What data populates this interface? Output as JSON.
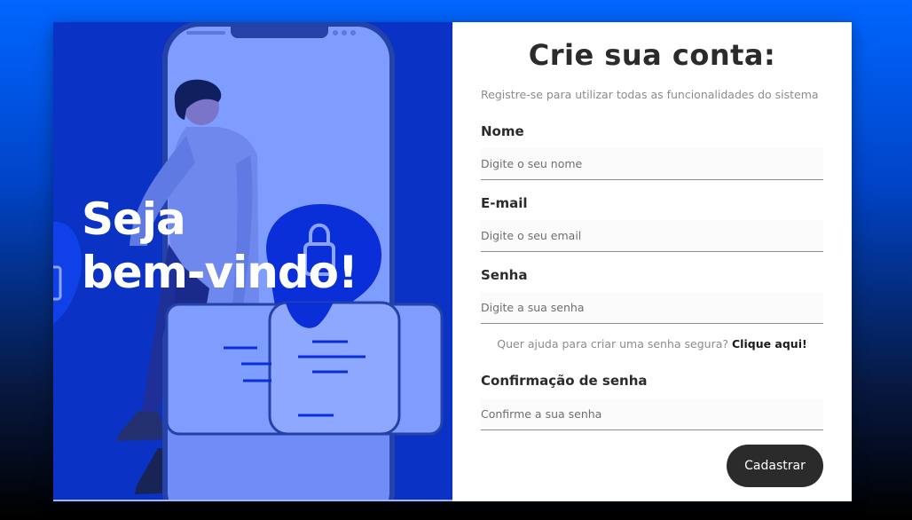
{
  "hero": {
    "line1": "Seja",
    "line2": "bem-vindo!"
  },
  "form": {
    "title": "Crie sua conta:",
    "subtitle": "Registre-se para utilizar todas as funcionalidades do sistema",
    "fields": [
      {
        "label": "Nome",
        "placeholder": "Digite o seu nome",
        "value": ""
      },
      {
        "label": "E-mail",
        "placeholder": "Digite o seu email",
        "value": ""
      },
      {
        "label": "Senha",
        "placeholder": "Digite a sua senha",
        "value": ""
      },
      {
        "label": "Confirmação de senha",
        "placeholder": "Confirme a sua senha",
        "value": ""
      }
    ],
    "help_text": "Quer ajuda para criar uma senha segura?",
    "help_link": "Clique aqui!",
    "submit_label": "Cadastrar"
  },
  "colors": {
    "left_panel": "#0a32c4",
    "illustration_light": "#7f9cff",
    "button": "#2b2b2b"
  }
}
